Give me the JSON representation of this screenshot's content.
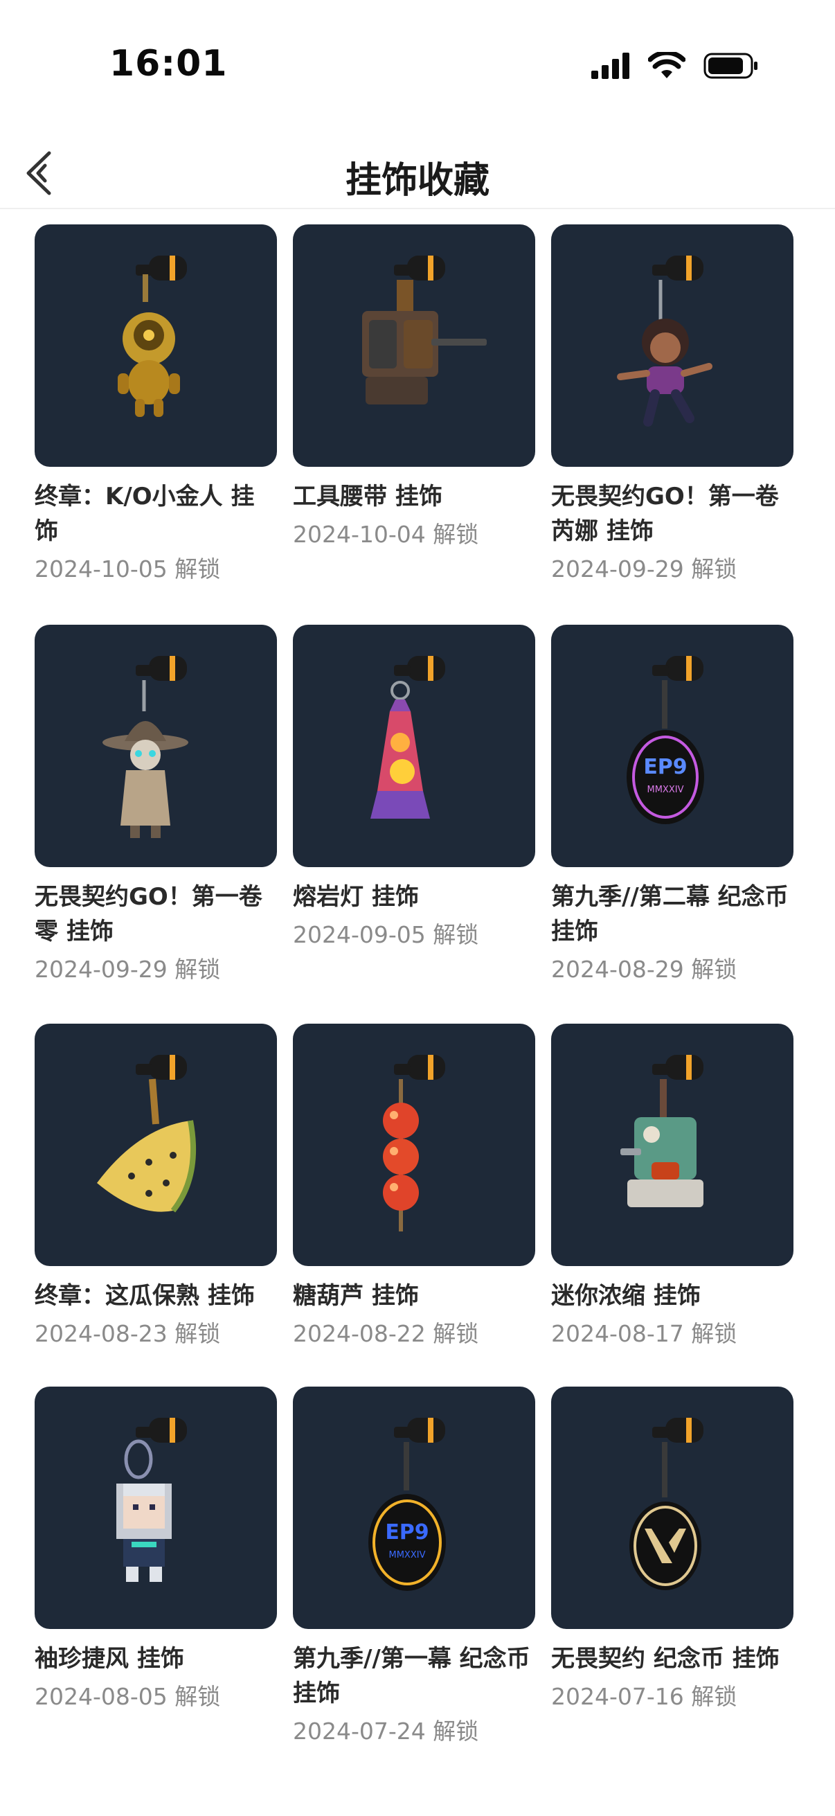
{
  "status_bar": {
    "time": "16:01"
  },
  "header": {
    "title": "挂饰收藏"
  },
  "items": [
    {
      "title": "终章：K/O小金人 挂饰",
      "date": "2024-10-05 解锁",
      "icon": "golden-robot-charm"
    },
    {
      "title": "工具腰带 挂饰",
      "date": "2024-10-04 解锁",
      "icon": "tool-belt-charm"
    },
    {
      "title": "无畏契约GO！第一卷 芮娜 挂饰",
      "date": "2024-09-29 解锁",
      "icon": "reyna-chibi-charm"
    },
    {
      "title": "无畏契约GO！第一卷 零 挂饰",
      "date": "2024-09-29 解锁",
      "icon": "cypher-chibi-charm"
    },
    {
      "title": "熔岩灯 挂饰",
      "date": "2024-09-05 解锁",
      "icon": "lava-lamp-charm"
    },
    {
      "title": "第九季//第二幕 纪念币 挂饰",
      "date": "2024-08-29 解锁",
      "icon": "ep9-purple-coin-charm"
    },
    {
      "title": "终章：这瓜保熟 挂饰",
      "date": "2024-08-23 解锁",
      "icon": "melon-slice-charm"
    },
    {
      "title": "糖葫芦 挂饰",
      "date": "2024-08-22 解锁",
      "icon": "candied-haws-charm"
    },
    {
      "title": "迷你浓缩 挂饰",
      "date": "2024-08-17 解锁",
      "icon": "espresso-machine-charm"
    },
    {
      "title": "袖珍捷风 挂饰",
      "date": "2024-08-05 解锁",
      "icon": "pixel-jett-charm"
    },
    {
      "title": "第九季//第一幕 纪念币 挂饰",
      "date": "2024-07-24 解锁",
      "icon": "ep9-blue-coin-charm"
    },
    {
      "title": "无畏契约 纪念币 挂饰",
      "date": "2024-07-16 解锁",
      "icon": "valorant-coin-charm"
    }
  ],
  "colors": {
    "card_bg": "#1e2938",
    "accent_orange": "#f2a32a",
    "date_grey": "#8a8a8a"
  }
}
